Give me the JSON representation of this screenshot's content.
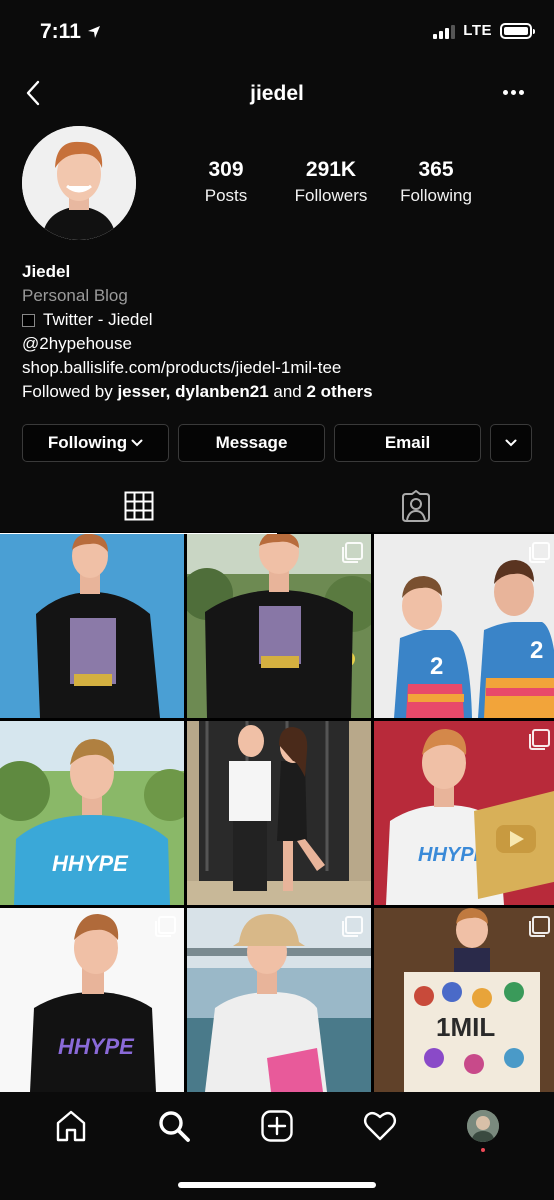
{
  "status_bar": {
    "time": "7:11",
    "network": "LTE"
  },
  "header": {
    "username": "jiedel",
    "back_icon": "chevron-left-icon",
    "more_icon": "more-horizontal-icon"
  },
  "profile": {
    "stats": [
      {
        "value": "309",
        "label": "Posts"
      },
      {
        "value": "291K",
        "label": "Followers"
      },
      {
        "value": "365",
        "label": "Following"
      }
    ],
    "name": "Jiedel",
    "category": "Personal Blog",
    "twitter_line": "Twitter - Jiedel",
    "handle": "@2hypehouse",
    "link": "shop.ballislife.com/products/jiedel-1mil-tee",
    "followed_by_prefix": "Followed by",
    "followed_by_users": "jesser, dylanben21",
    "followed_by_and": "and",
    "followed_by_others": "2 others"
  },
  "actions": {
    "following_label": "Following",
    "message_label": "Message",
    "email_label": "Email"
  },
  "tabs": [
    {
      "icon": "grid-icon",
      "active": true
    },
    {
      "icon": "tagged-person-icon",
      "active": false
    }
  ],
  "bottom_nav": [
    {
      "icon": "home-icon"
    },
    {
      "icon": "search-icon"
    },
    {
      "icon": "add-post-icon"
    },
    {
      "icon": "heart-icon"
    },
    {
      "icon": "profile-avatar"
    }
  ],
  "colors": {
    "background": "#000000",
    "surface": "#0b0b0b",
    "secondary_text": "#9a9a9a",
    "button_border": "#3a3a3a",
    "notification_dot": "#ed4956"
  }
}
